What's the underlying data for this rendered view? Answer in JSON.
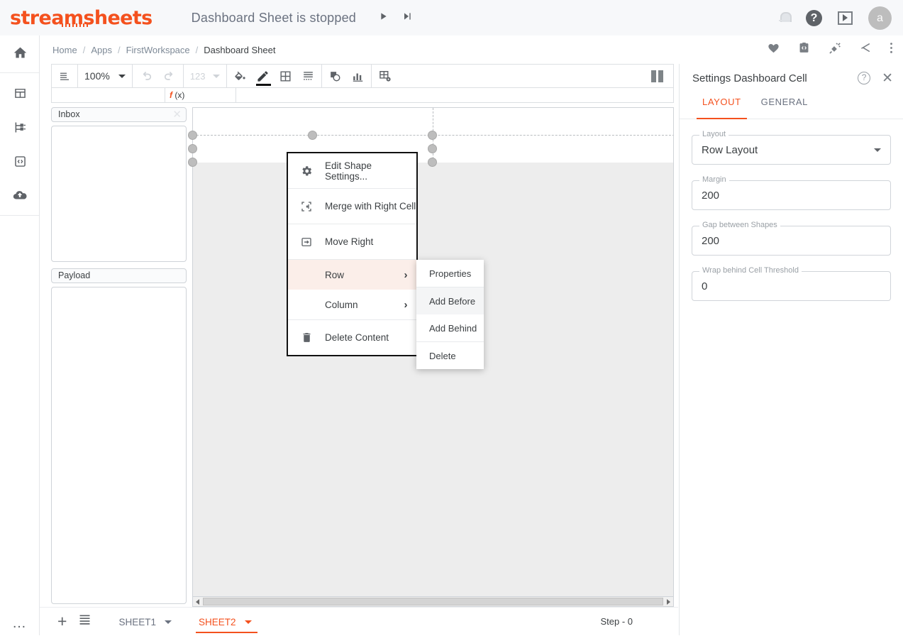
{
  "appbar": {
    "logo": "streamsheets",
    "title": "Dashboard Sheet is stopped",
    "play_icon": "play-icon",
    "step_icon": "step-forward-icon",
    "notifications_icon": "bell-icon",
    "help_icon": "help-icon",
    "video_icon": "play-box-icon",
    "avatar_initial": "a",
    "accent_color": "#f4511e"
  },
  "rail": {
    "items": [
      {
        "name": "home",
        "icon": "home-icon"
      },
      {
        "name": "sheets",
        "icon": "table-icon"
      },
      {
        "name": "streams",
        "icon": "streams-icon"
      },
      {
        "name": "code",
        "icon": "code-clipboard-icon"
      },
      {
        "name": "export",
        "icon": "cloud-upload-icon"
      }
    ],
    "more": "…"
  },
  "breadcrumb": {
    "items": [
      "Home",
      "Apps",
      "FirstWorkspace",
      "Dashboard Sheet"
    ],
    "separator": "/",
    "actions": [
      {
        "name": "favorite",
        "icon": "heart-icon"
      },
      {
        "name": "source",
        "icon": "code-box-icon"
      },
      {
        "name": "connect",
        "icon": "plug-icon"
      },
      {
        "name": "share",
        "icon": "share-icon"
      },
      {
        "name": "more",
        "icon": "more-vert-icon"
      }
    ]
  },
  "toolbar": {
    "menu_icon": "sheet-menu-icon",
    "zoom_value": "100%",
    "undo_icon": "undo-icon",
    "redo_icon": "redo-icon",
    "number_format": "123",
    "fill_icon": "fill-bucket-icon",
    "pen_icon": "pen-icon",
    "table_icon": "table-grid-icon",
    "borders_icon": "borders-icon",
    "shapes_icon": "shapes-icon",
    "chart_icon": "chart-icon",
    "table_settings_icon": "table-settings-icon",
    "pause_icon": "pause-icon"
  },
  "formula_bar": {
    "fx_label": "f (x)",
    "name_value": "",
    "formula_value": ""
  },
  "panels": [
    {
      "title": "Inbox",
      "close_icon": "close-icon",
      "content": ""
    },
    {
      "title": "Payload",
      "close_icon": "close-icon",
      "content": ""
    }
  ],
  "context_menu": {
    "items": [
      {
        "label": "Edit Shape Settings...",
        "icon": "gear-icon",
        "type": "item"
      },
      {
        "label": "Merge with Right Cell",
        "icon": "merge-cell-icon",
        "type": "item"
      },
      {
        "label": "Move Right",
        "icon": "move-right-icon",
        "type": "item"
      },
      {
        "label": "Row",
        "icon": "",
        "type": "submenu",
        "highlighted": true,
        "arrow": "›"
      },
      {
        "label": "Column",
        "icon": "",
        "type": "submenu",
        "highlighted": false,
        "arrow": "›"
      },
      {
        "label": "Delete Content",
        "icon": "trash-icon",
        "type": "item"
      }
    ]
  },
  "submenu": {
    "items": [
      {
        "label": "Properties",
        "highlighted": false
      },
      {
        "label": "Add Before",
        "highlighted": true
      },
      {
        "label": "Add Behind",
        "highlighted": false
      },
      {
        "label": "Delete",
        "highlighted": false
      }
    ]
  },
  "settings": {
    "title": "Settings Dashboard Cell",
    "help_icon": "help-circle-icon",
    "close_icon": "close-icon",
    "tabs": [
      {
        "label": "LAYOUT",
        "active": true
      },
      {
        "label": "GENERAL",
        "active": false
      }
    ],
    "fields": [
      {
        "label": "Layout",
        "value": "Row Layout",
        "type": "select"
      },
      {
        "label": "Margin",
        "value": "200",
        "type": "text"
      },
      {
        "label": "Gap between Shapes",
        "value": "200",
        "type": "text"
      },
      {
        "label": "Wrap behind Cell Threshold",
        "value": "0",
        "type": "text"
      }
    ]
  },
  "sheetbar": {
    "add_icon": "plus-icon",
    "list_icon": "sheet-list-icon",
    "tabs": [
      {
        "label": "SHEET1",
        "active": false
      },
      {
        "label": "SHEET2",
        "active": true
      }
    ],
    "step_label": "Step - 0"
  },
  "scrollbar": {
    "left_arrow": "arrow-left-icon",
    "right_arrow": "arrow-right-icon"
  }
}
